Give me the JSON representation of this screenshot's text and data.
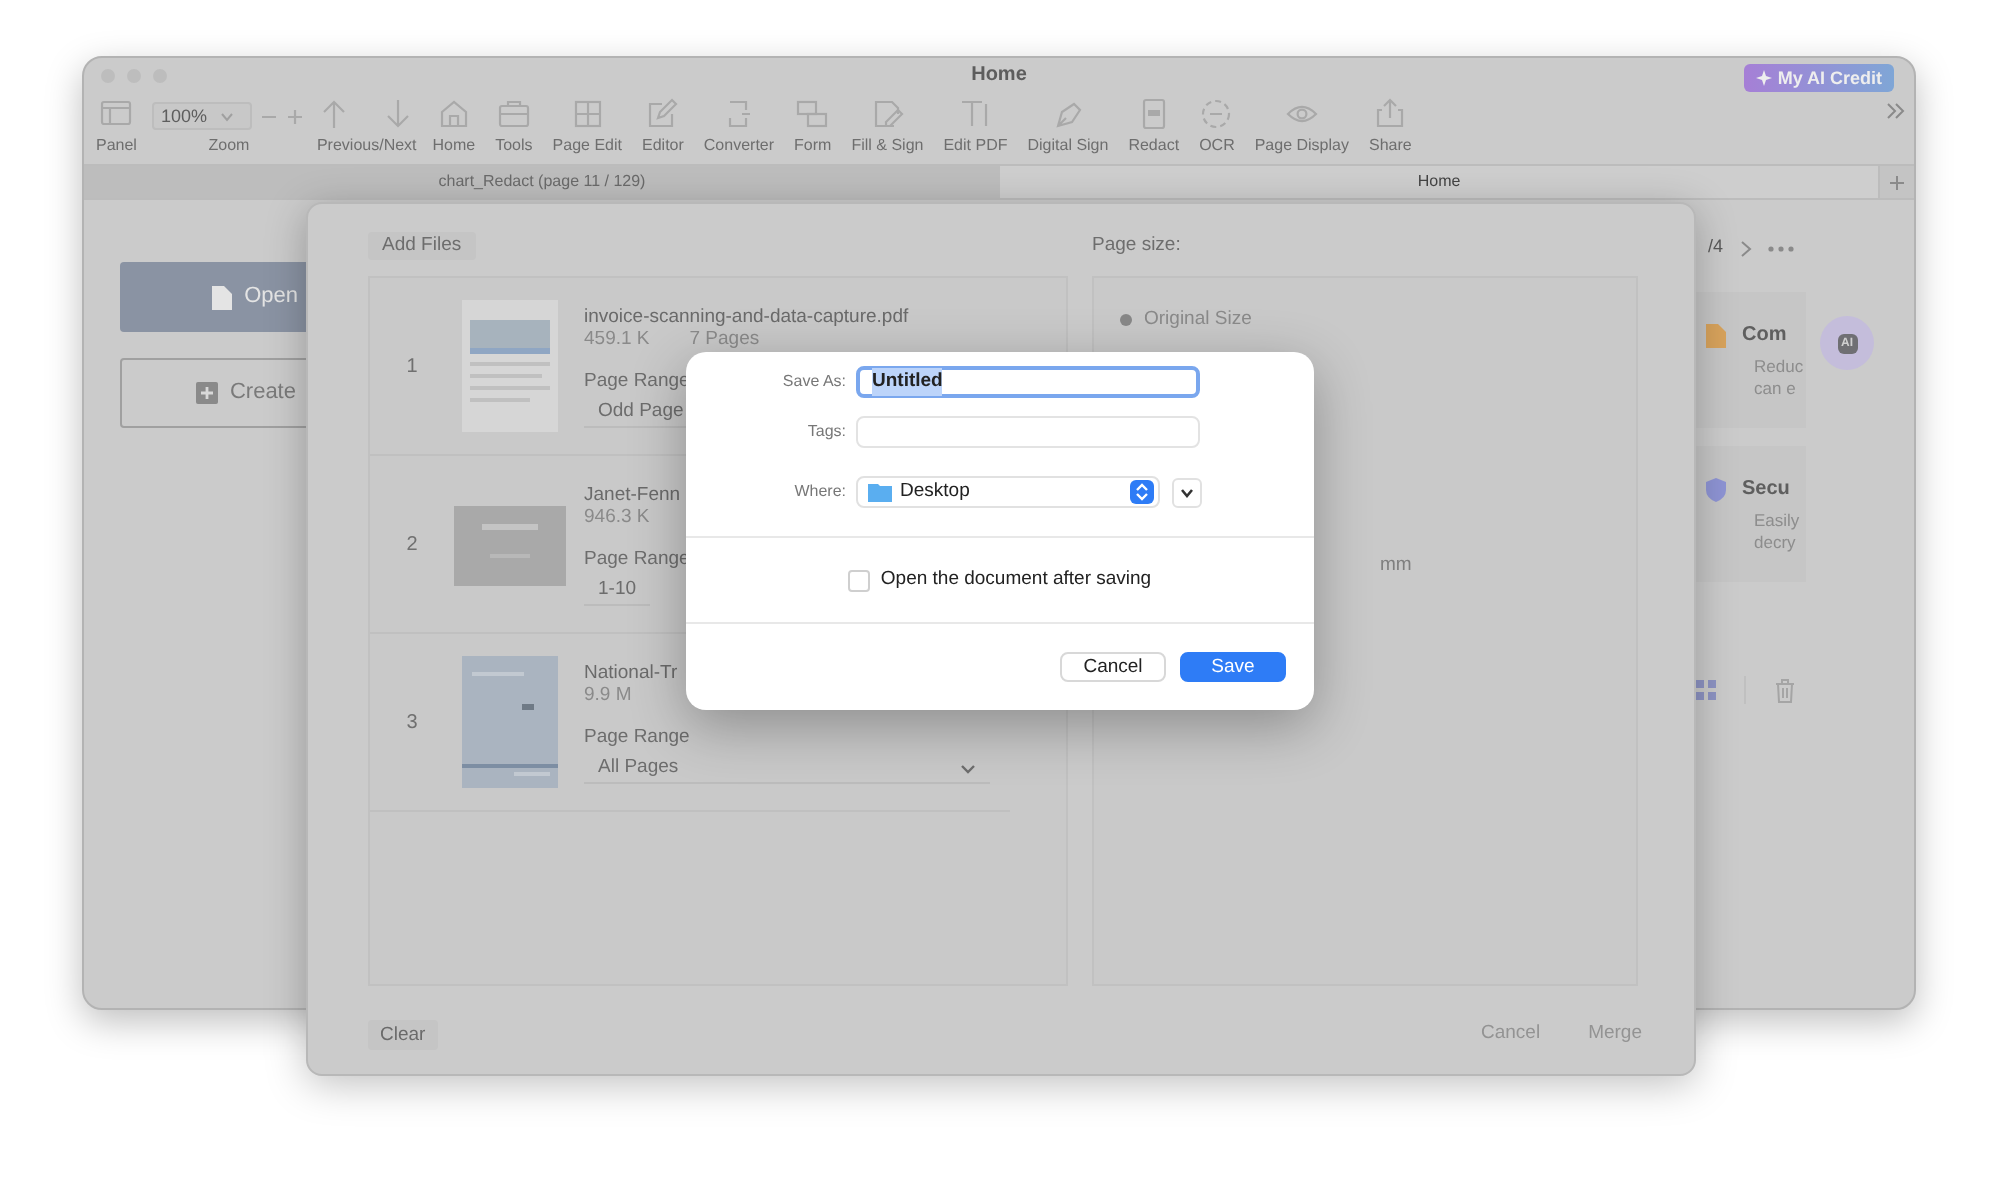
{
  "app": {
    "title": "Home",
    "ai_credit": "My AI Credit",
    "toolbar": [
      {
        "kind": "tool",
        "label": "Panel"
      },
      {
        "kind": "zoom",
        "label": "Zoom",
        "value": "100%"
      },
      {
        "kind": "pager",
        "label": "Previous/Next"
      },
      {
        "kind": "tool",
        "label": "Home"
      },
      {
        "kind": "tool",
        "label": "Tools"
      },
      {
        "kind": "tool",
        "label": "Page Edit"
      },
      {
        "kind": "tool",
        "label": "Editor"
      },
      {
        "kind": "tool",
        "label": "Converter"
      },
      {
        "kind": "tool",
        "label": "Form"
      },
      {
        "kind": "tool",
        "label": "Fill & Sign"
      },
      {
        "kind": "tool",
        "label": "Edit PDF"
      },
      {
        "kind": "tool",
        "label": "Digital Sign"
      },
      {
        "kind": "tool",
        "label": "Redact"
      },
      {
        "kind": "tool",
        "label": "OCR"
      },
      {
        "kind": "tool",
        "label": "Page Display"
      },
      {
        "kind": "tool",
        "label": "Share"
      }
    ],
    "tabs": [
      {
        "label": "chart_Redact (page 11 / 129)",
        "selected": false
      },
      {
        "label": "Home",
        "selected": true
      }
    ],
    "home": {
      "actions": [
        {
          "kind": "primary",
          "label": "Open"
        },
        {
          "kind": "outline",
          "label": "Create"
        }
      ],
      "pager": "/4",
      "cards": [
        {
          "title": "Com",
          "lines": [
            "Reduc",
            "can e"
          ],
          "color": "#d8a35c"
        },
        {
          "title": "Secu",
          "lines": [
            "Easily",
            "decry"
          ],
          "color": "#8e94d4"
        }
      ],
      "ai_button": "AI"
    }
  },
  "merge": {
    "add_files": "Add Files",
    "files": [
      {
        "index": "1",
        "name": "invoice-scanning-and-data-capture.pdf",
        "size": "459.1 K",
        "pages": "7 Pages",
        "range_label": "Page Range",
        "range": "Odd Page",
        "chevron": false
      },
      {
        "index": "2",
        "name": "Janet-Fenn",
        "size": "946.3 K",
        "range_label": "Page Range",
        "range": "1-10",
        "chevron": false
      },
      {
        "index": "3",
        "name": "National-Tr",
        "size": "9.9 M",
        "range_label": "Page Range",
        "range": "All Pages",
        "chevron": true
      }
    ],
    "page_size": {
      "label": "Page size:",
      "options": [
        {
          "label": "Original Size",
          "selected": true
        }
      ],
      "unit": "mm"
    },
    "clear": "Clear",
    "actions": [
      {
        "label": "Cancel",
        "disabled": true
      },
      {
        "label": "Merge",
        "disabled": true
      }
    ]
  },
  "save": {
    "fields": [
      {
        "label": "Save As:",
        "value": "Untitled",
        "focused": true
      },
      {
        "label": "Tags:",
        "focused": false
      }
    ],
    "where": {
      "label": "Where:",
      "value": "Desktop"
    },
    "open_after": {
      "label": "Open the document after saving",
      "checked": false
    },
    "buttons": [
      {
        "label": "Cancel",
        "kind": "secondary"
      },
      {
        "label": "Save",
        "kind": "primary"
      }
    ]
  }
}
